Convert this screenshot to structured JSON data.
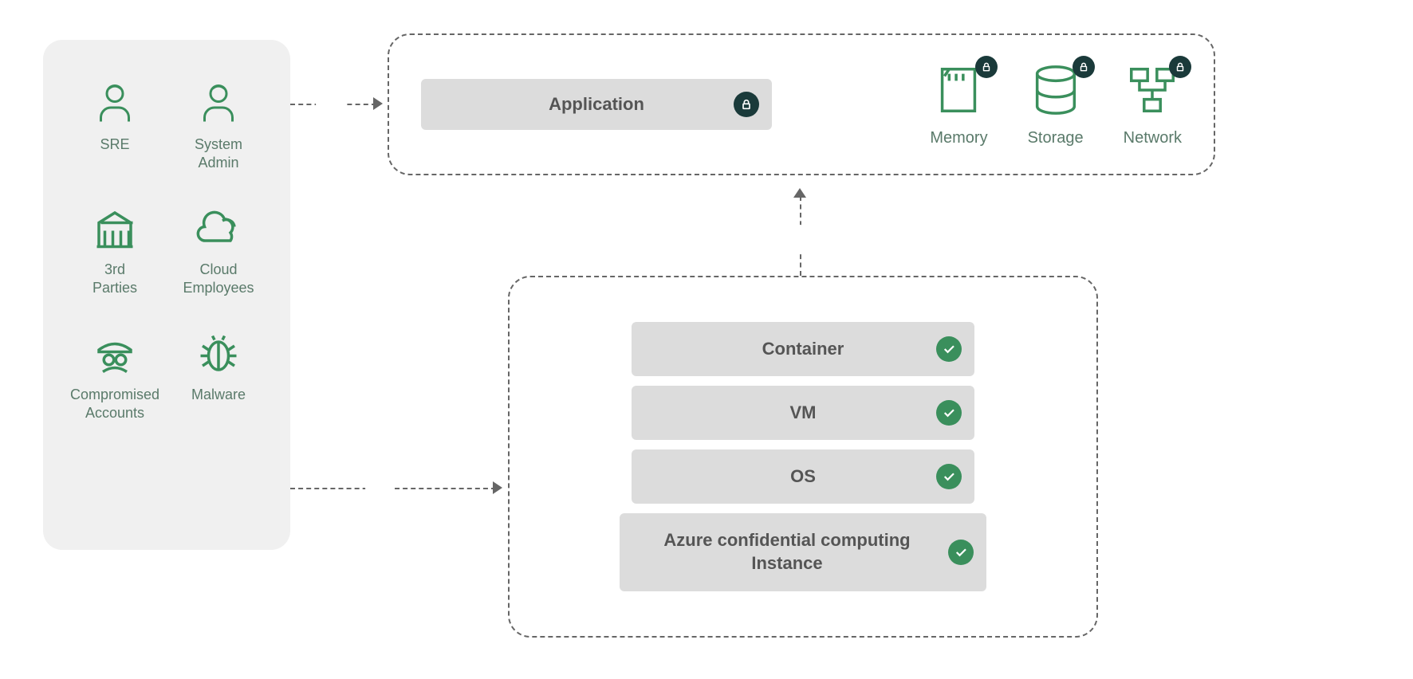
{
  "threats": {
    "sre": "SRE",
    "sysadmin": "System\nAdmin",
    "third": "3rd\nParties",
    "cloud": "Cloud\nEmployees",
    "comp": "Compromised\nAccounts",
    "malware": "Malware"
  },
  "app": {
    "label": "Application",
    "memory": "Memory",
    "storage": "Storage",
    "network": "Network"
  },
  "stack": {
    "container": "Container",
    "vm": "VM",
    "os": "OS",
    "azure": "Azure confidential computing Instance"
  }
}
